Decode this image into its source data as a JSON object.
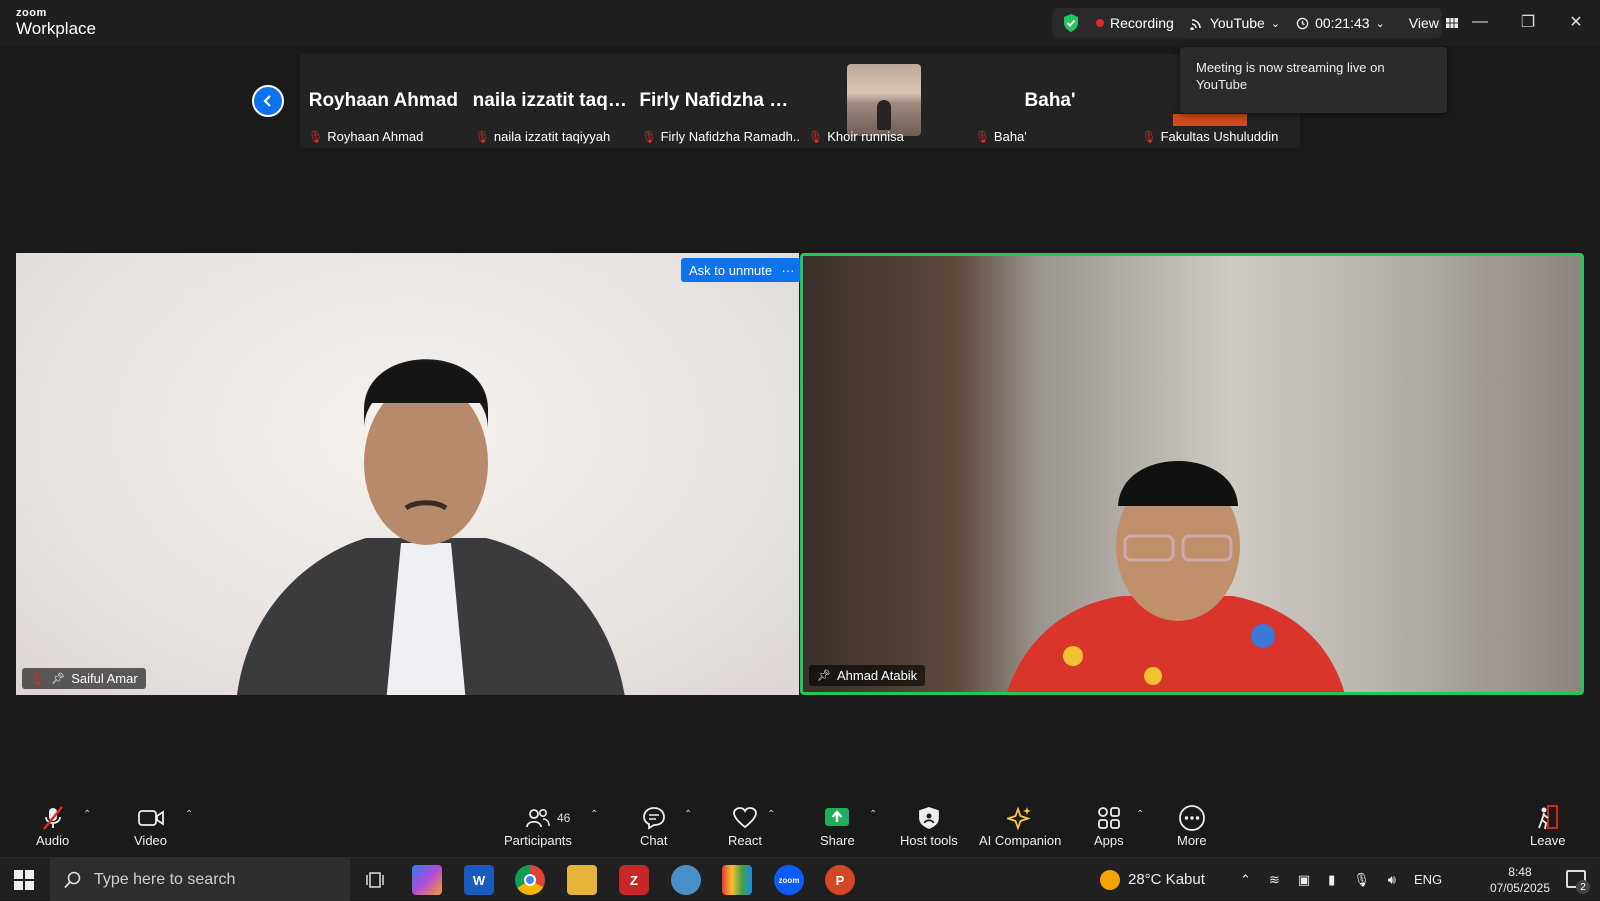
{
  "app": {
    "logo_small": "zoom",
    "logo_big": "Workplace"
  },
  "status": {
    "recording_label": "Recording",
    "stream_label": "YouTube",
    "timer": "00:21:43",
    "view_label": "View"
  },
  "tooltip": {
    "text": "Meeting is now streaming live on YouTube"
  },
  "strip": {
    "tiles": [
      {
        "big_name": "Royhaan Ahmad",
        "label": "Royhaan Ahmad"
      },
      {
        "big_name": "naila izzatit taqi...",
        "label": "naila izzatit taqiyyah"
      },
      {
        "big_name": "Firly Nafidzha R...",
        "label": "Firly Nafidzha Ramadh..."
      },
      {
        "big_name": "",
        "label": "Khoir runnisa"
      },
      {
        "big_name": "Baha'",
        "label": "Baha'"
      },
      {
        "big_name": "",
        "label": "Fakultas Ushuluddin"
      }
    ]
  },
  "videos": {
    "left_name": "Saiful Amar",
    "right_name": "Ahmad Atabik",
    "ask_unmute": "Ask to unmute",
    "more_dots": "···"
  },
  "toolbar": {
    "audio": "Audio",
    "video": "Video",
    "participants": "Participants",
    "participant_count": "46",
    "chat": "Chat",
    "react": "React",
    "share": "Share",
    "host_tools": "Host tools",
    "ai_companion": "AI Companion",
    "apps": "Apps",
    "more": "More",
    "leave": "Leave"
  },
  "taskbar": {
    "search_placeholder": "Type here to search",
    "weather": "28°C  Kabut",
    "lang": "ENG",
    "time": "8:48",
    "date": "07/05/2025",
    "notif_count": "2"
  },
  "colors": {
    "accent": "#0e72ed",
    "active_speaker": "#22c55e",
    "muted": "#e02828",
    "share": "#1fae5b"
  }
}
